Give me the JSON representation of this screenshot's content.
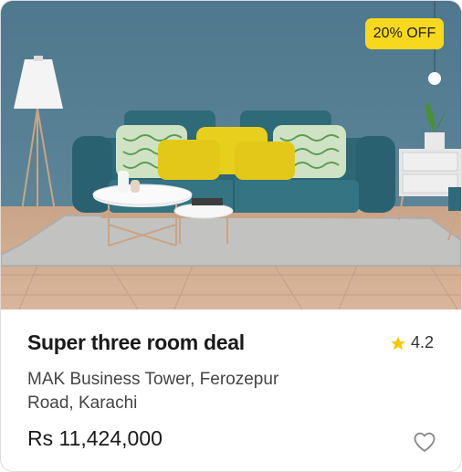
{
  "listing": {
    "discount_badge": "20% OFF",
    "title": "Super three room deal",
    "rating": "4.2",
    "address": "MAK Business Tower, Ferozepur Road, Karachi",
    "price": "Rs 11,424,000"
  },
  "icons": {
    "rating": "star-icon",
    "favorite": "heart-outline-icon"
  },
  "colors": {
    "badge_bg": "#f7d81f",
    "star": "#f5c800",
    "wall": "#557e93",
    "sofa": "#2f6a78",
    "pillow_yellow": "#e8cf1e"
  }
}
